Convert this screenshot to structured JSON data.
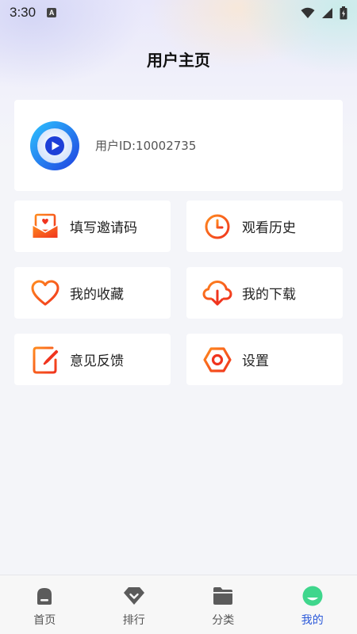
{
  "status_bar": {
    "time": "3:30",
    "notification_icon": "a-letter-icon",
    "wifi_icon": "wifi-icon",
    "signal_icon": "signal-icon",
    "battery_icon": "battery-icon"
  },
  "header": {
    "title": "用户主页"
  },
  "profile": {
    "avatar_icon": "play-circle-icon",
    "user_id": "用户ID:10002735"
  },
  "menu": {
    "items": [
      {
        "label": "填写邀请码",
        "icon": "envelope-heart-icon"
      },
      {
        "label": "观看历史",
        "icon": "clock-icon"
      },
      {
        "label": "我的收藏",
        "icon": "heart-icon"
      },
      {
        "label": "我的下载",
        "icon": "cloud-download-icon"
      },
      {
        "label": "意见反馈",
        "icon": "edit-note-icon"
      },
      {
        "label": "设置",
        "icon": "hexagon-gear-icon"
      }
    ]
  },
  "bottom_nav": {
    "items": [
      {
        "label": "首页",
        "icon": "home-icon"
      },
      {
        "label": "排行",
        "icon": "ranking-icon"
      },
      {
        "label": "分类",
        "icon": "folder-icon"
      },
      {
        "label": "我的",
        "icon": "profile-icon"
      }
    ],
    "active_index": 3
  },
  "colors": {
    "accent_orange": "#f0561e",
    "accent_blue": "#2b59d9",
    "nav_active_green": "#3fd68c"
  }
}
